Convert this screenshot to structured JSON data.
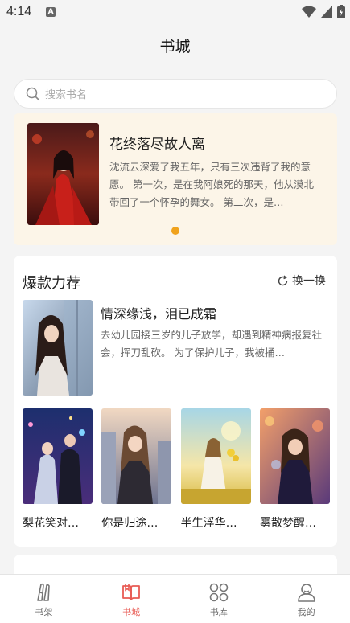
{
  "status_bar": {
    "time": "4:14",
    "notification_icon": "A"
  },
  "header": {
    "title": "书城"
  },
  "search": {
    "placeholder": "搜索书名"
  },
  "banner": {
    "title": "花终落尽故人离",
    "description": "沈流云深爱了我五年，只有三次违背了我的意愿。 第一次，是在我阿娘死的那天，他从漠北带回了一个怀孕的舞女。 第二次，是…",
    "active_dot_color": "#f0a21c"
  },
  "recommend": {
    "title": "爆款力荐",
    "refresh_label": "换一换",
    "main_book": {
      "title": "情深缘浅，泪已成霜",
      "description": "去幼儿园接三岁的儿子放学，却遇到精神病报复社会，挥刀乱砍。 为了保护儿子，我被捅…"
    },
    "books": [
      {
        "title": "梨花笑对…"
      },
      {
        "title": "你是归途…"
      },
      {
        "title": "半生浮华…"
      },
      {
        "title": "雾散梦醒…"
      }
    ]
  },
  "bottom_nav": {
    "items": [
      {
        "label": "书架",
        "icon": "bookshelf-icon"
      },
      {
        "label": "书城",
        "icon": "book-open-icon"
      },
      {
        "label": "书库",
        "icon": "grid-icon"
      },
      {
        "label": "我的",
        "icon": "user-icon"
      }
    ],
    "active_color": "#e85b54"
  }
}
